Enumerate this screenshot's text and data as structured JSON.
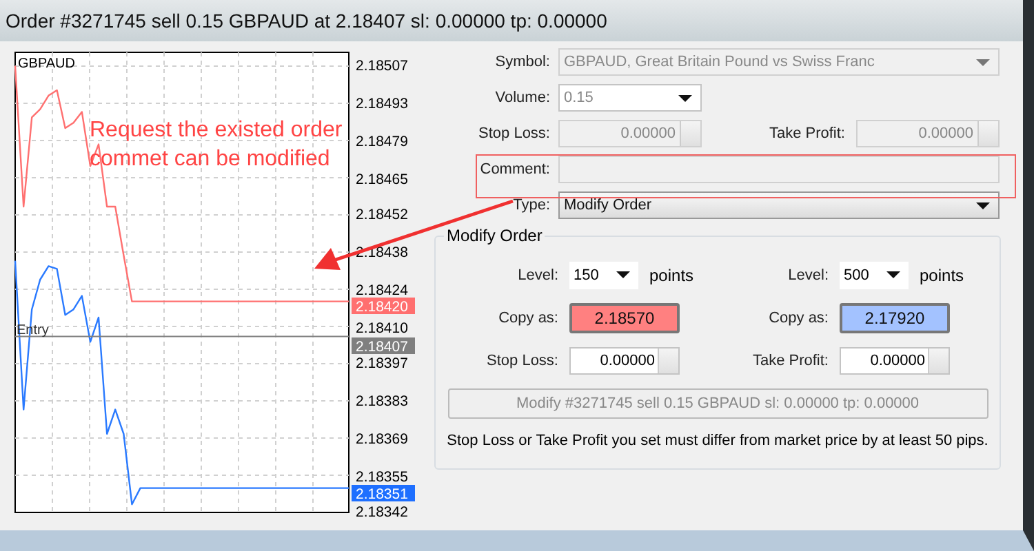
{
  "window": {
    "title": "Order #3271745 sell 0.15 GBPAUD at 2.18407 sl: 0.00000 tp: 0.00000"
  },
  "chart": {
    "symbol": "GBPAUD",
    "chart_data": {
      "type": "line",
      "ylim": [
        2.18342,
        2.18512
      ],
      "grid": true,
      "ref_lines": [
        {
          "axis": "y",
          "value": 2.18407,
          "label": "Entry",
          "color": "#808080"
        }
      ],
      "yticks": [
        {
          "value": 2.18507,
          "label": "2.18507"
        },
        {
          "value": 2.18493,
          "label": "2.18493"
        },
        {
          "value": 2.18479,
          "label": "2.18479"
        },
        {
          "value": 2.18465,
          "label": "2.18465"
        },
        {
          "value": 2.18452,
          "label": "2.18452"
        },
        {
          "value": 2.18438,
          "label": "2.18438"
        },
        {
          "value": 2.18424,
          "label": "2.18424"
        },
        {
          "value": 2.1841,
          "label": "2.18410"
        },
        {
          "value": 2.18397,
          "label": "2.18397"
        },
        {
          "value": 2.18383,
          "label": "2.18383"
        },
        {
          "value": 2.18369,
          "label": "2.18369"
        },
        {
          "value": 2.18355,
          "label": "2.18355"
        },
        {
          "value": 2.18342,
          "label": "2.18342"
        }
      ],
      "categories": [
        null,
        null,
        null,
        null,
        null,
        null,
        null,
        null,
        null,
        null,
        null,
        null,
        null,
        null,
        null,
        null,
        null,
        null,
        null,
        null,
        null,
        null,
        null,
        null,
        null,
        null,
        null,
        null,
        null,
        null,
        null,
        null,
        null,
        null,
        null,
        null,
        null,
        null,
        null,
        null,
        null
      ],
      "series": [
        {
          "color": "#ff7070",
          "values": [
            2.18507,
            2.18455,
            2.18488,
            2.18491,
            2.18496,
            2.18498,
            2.18484,
            2.18486,
            2.1849,
            2.1847,
            2.18478,
            2.18455,
            2.18455,
            2.18437,
            2.1842,
            2.1842,
            2.1842,
            2.1842,
            2.1842,
            2.1842,
            2.1842,
            2.1842,
            2.1842,
            2.1842,
            2.1842,
            2.1842,
            2.1842,
            2.1842,
            2.1842,
            2.1842,
            2.1842,
            2.1842,
            2.1842,
            2.1842,
            2.1842,
            2.1842,
            2.1842,
            2.1842,
            2.1842,
            2.1842,
            2.1842
          ]
        },
        {
          "color": "#2a7aff",
          "values": [
            2.18435,
            2.1838,
            2.18417,
            2.18428,
            2.18433,
            2.18432,
            2.18415,
            2.18417,
            2.18422,
            2.18405,
            2.18414,
            2.18371,
            2.1838,
            2.18371,
            2.18345,
            2.18351,
            2.18351,
            2.18351,
            2.18351,
            2.18351,
            2.18351,
            2.18351,
            2.18351,
            2.18351,
            2.18351,
            2.18351,
            2.18351,
            2.18351,
            2.18351,
            2.18351,
            2.18351,
            2.18351,
            2.18351,
            2.18351,
            2.18351,
            2.18351,
            2.18351,
            2.18351,
            2.18351,
            2.18351,
            2.18351
          ]
        }
      ]
    },
    "price_tags": [
      {
        "text": "2.18420",
        "color": "#ff6f6f"
      },
      {
        "text": "2.18407",
        "color": "#7f7f7f"
      },
      {
        "text": "2.18351",
        "color": "#1e6fff"
      }
    ]
  },
  "annotation": {
    "lines": [
      "Request the existed order",
      "commet can be modified"
    ]
  },
  "form": {
    "symbol": {
      "label": "Symbol:",
      "value": "GBPAUD, Great Britain Pound vs Swiss Franc"
    },
    "volume": {
      "label": "Volume:",
      "value": "0.15"
    },
    "stop_loss": {
      "label": "Stop Loss:",
      "value": "0.00000"
    },
    "take_profit": {
      "label": "Take Profit:",
      "value": "0.00000"
    },
    "comment": {
      "label": "Comment:"
    },
    "type": {
      "label": "Type:",
      "value": "Modify Order"
    }
  },
  "modify_group": {
    "title": "Modify Order",
    "levels": [
      {
        "label": "Level:",
        "value": "150",
        "unit": "points"
      },
      {
        "label": "Level:",
        "value": "500",
        "unit": "points"
      }
    ],
    "copy_buttons": [
      {
        "label": "Copy as:",
        "value": "2.18570",
        "color": "#ff8080"
      },
      {
        "label": "Copy as:",
        "value": "2.17920",
        "color": "#a3c2ff"
      }
    ],
    "stops": [
      {
        "label": "Stop Loss:",
        "value": "0.00000"
      },
      {
        "label": "Take Profit:",
        "value": "0.00000"
      }
    ],
    "button": "Modify #3271745 sell 0.15 GBPAUD sl: 0.00000 tp: 0.00000",
    "note": "Stop Loss or Take Profit you set must differ from market price by at least 50 pips."
  }
}
